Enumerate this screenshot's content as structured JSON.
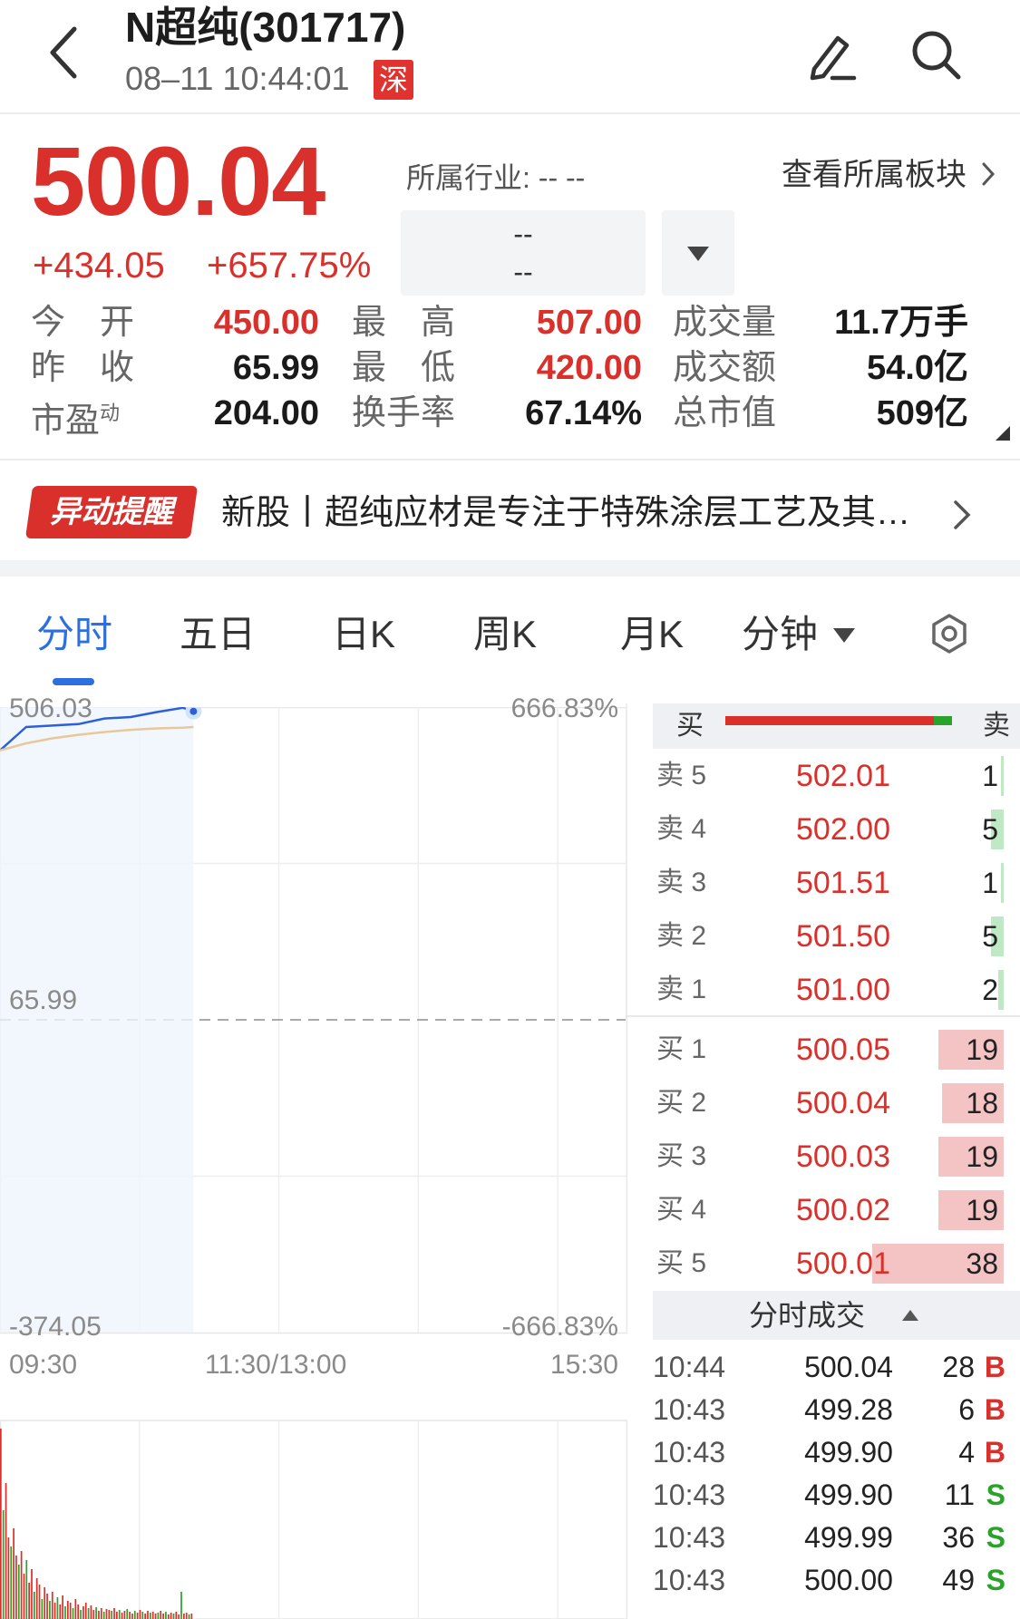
{
  "header": {
    "title": "N超纯(301717)",
    "datetime": "08–11 10:44:01",
    "exchange": "深"
  },
  "quote": {
    "price": "500.04",
    "change": "+434.05",
    "change_pct": "+657.75%",
    "industry_label": "所属行业: -- --",
    "sector_link": "查看所属板块",
    "sector_value_1": "--",
    "sector_value_2": "--",
    "stats": [
      {
        "label": "今　开",
        "value": "450.00",
        "color": "red"
      },
      {
        "label": "最　高",
        "value": "507.00",
        "color": "red"
      },
      {
        "label": "成交量",
        "value": "11.7万手",
        "color": "dark"
      },
      {
        "label": "昨　收",
        "value": "65.99",
        "color": "dark"
      },
      {
        "label": "最　低",
        "value": "420.00",
        "color": "red"
      },
      {
        "label": "成交额",
        "value": "54.0亿",
        "color": "dark"
      },
      {
        "label": "市盈",
        "label_sup": "动",
        "value": "204.00",
        "color": "dark"
      },
      {
        "label": "换手率",
        "value": "67.14%",
        "color": "dark"
      },
      {
        "label": "总市值",
        "value": "509亿",
        "color": "dark"
      }
    ]
  },
  "alert": {
    "badge": "异动提醒",
    "text": "新股丨超纯应材是专注于特殊涂层工艺及其…"
  },
  "tabs": [
    "分时",
    "五日",
    "日K",
    "周K",
    "月K",
    "分钟"
  ],
  "active_tab": "分时",
  "chart": {
    "y_top_left": "506.03",
    "y_top_right": "666.83%",
    "y_mid": "65.99",
    "y_bottom_left": "-374.05",
    "y_bottom_right": "-666.83%",
    "x_labels": [
      "09:30",
      "11:30/13:00",
      "15:30"
    ]
  },
  "chart_data": {
    "type": "line",
    "title": "",
    "series": [
      {
        "name": "",
        "x": [
          "09:30",
          "09:40",
          "09:50",
          "10:00",
          "10:10",
          "10:20",
          "10:30",
          "10:40",
          "10:44"
        ],
        "values": [
          445,
          478,
          480,
          482,
          490,
          492,
          499,
          505,
          500.04
        ]
      },
      {
        "name": "",
        "x": [
          "09:30",
          "09:40",
          "09:50",
          "10:00",
          "10:10",
          "10:20",
          "10:30",
          "10:40",
          "10:44"
        ],
        "values": [
          445,
          455,
          462,
          467,
          471,
          474,
          476,
          477,
          478
        ]
      }
    ],
    "ylim": [
      -374.05,
      506.03
    ],
    "reference_line": 65.99,
    "colors": {
      "price": "#2d5fd8",
      "average": "#e8c89a"
    }
  },
  "order_book": {
    "buy_label": "买",
    "sell_label": "卖",
    "buy_ratio": 0.92,
    "asks": [
      {
        "label": "卖 5",
        "price": "502.01",
        "vol": "1",
        "bar": 0.02
      },
      {
        "label": "卖 4",
        "price": "502.00",
        "vol": "5",
        "bar": 0.1
      },
      {
        "label": "卖 3",
        "price": "501.51",
        "vol": "1",
        "bar": 0.02
      },
      {
        "label": "卖 2",
        "price": "501.50",
        "vol": "5",
        "bar": 0.1
      },
      {
        "label": "卖 1",
        "price": "501.00",
        "vol": "2",
        "bar": 0.04
      }
    ],
    "bids": [
      {
        "label": "买 1",
        "price": "500.05",
        "vol": "19",
        "bar": 0.5
      },
      {
        "label": "买 2",
        "price": "500.04",
        "vol": "18",
        "bar": 0.47
      },
      {
        "label": "买 3",
        "price": "500.03",
        "vol": "19",
        "bar": 0.5
      },
      {
        "label": "买 4",
        "price": "500.02",
        "vol": "19",
        "bar": 0.5
      },
      {
        "label": "买 5",
        "price": "500.01",
        "vol": "38",
        "bar": 1.0
      }
    ]
  },
  "ticks": {
    "title": "分时成交",
    "rows": [
      {
        "time": "10:44",
        "price": "500.04",
        "vol": "28",
        "side": "B"
      },
      {
        "time": "10:43",
        "price": "499.28",
        "vol": "6",
        "side": "B"
      },
      {
        "time": "10:43",
        "price": "499.90",
        "vol": "4",
        "side": "B"
      },
      {
        "time": "10:43",
        "price": "499.90",
        "vol": "11",
        "side": "S"
      },
      {
        "time": "10:43",
        "price": "499.99",
        "vol": "36",
        "side": "S"
      },
      {
        "time": "10:43",
        "price": "500.00",
        "vol": "49",
        "side": "S"
      }
    ]
  }
}
